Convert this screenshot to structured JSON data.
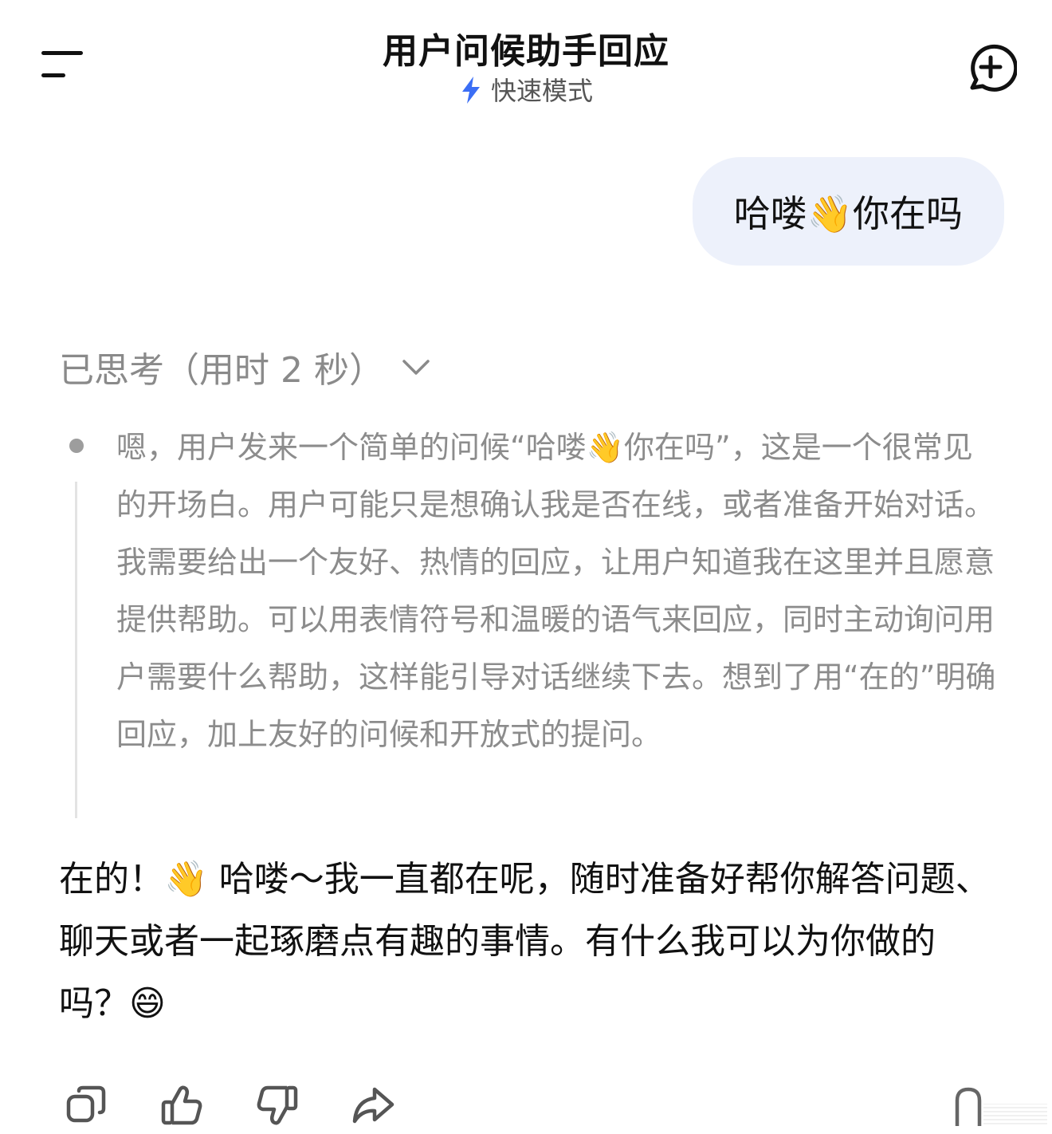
{
  "header": {
    "title": "用户问候助手回应",
    "mode_label": "快速模式",
    "menu_icon": "menu-icon",
    "new_chat_icon": "new-chat-plus-icon",
    "mode_icon": "lightning-bolt-icon",
    "accent_color": "#3b6ef5"
  },
  "user_message": {
    "text": "哈喽👋你在吗",
    "bubble_color": "#edf1fb"
  },
  "thinking": {
    "toggle_label": "已思考（用时 2 秒）",
    "toggle_icon": "chevron-down-icon",
    "text": "嗯，用户发来一个简单的问候“哈喽👋你在吗”，这是一个很常见的开场白。用户可能只是想确认我是否在线，或者准备开始对话。我需要给出一个友好、热情的回应，让用户知道我在这里并且愿意提供帮助。可以用表情符号和温暖的语气来回应，同时主动询问用户需要什么帮助，这样能引导对话继续下去。想到了用“在的”明确回应，加上友好的问候和开放式的提问。"
  },
  "answer": {
    "text": "在的！👋 哈喽～我一直都在呢，随时准备好帮你解答问题、聊天或者一起琢磨点有趣的事情。有什么我可以为你做的吗？😄"
  },
  "actions": {
    "icons": [
      "copy-icon",
      "thumbs-up-icon",
      "thumbs-down-icon",
      "share-icon",
      "more-icon"
    ]
  }
}
